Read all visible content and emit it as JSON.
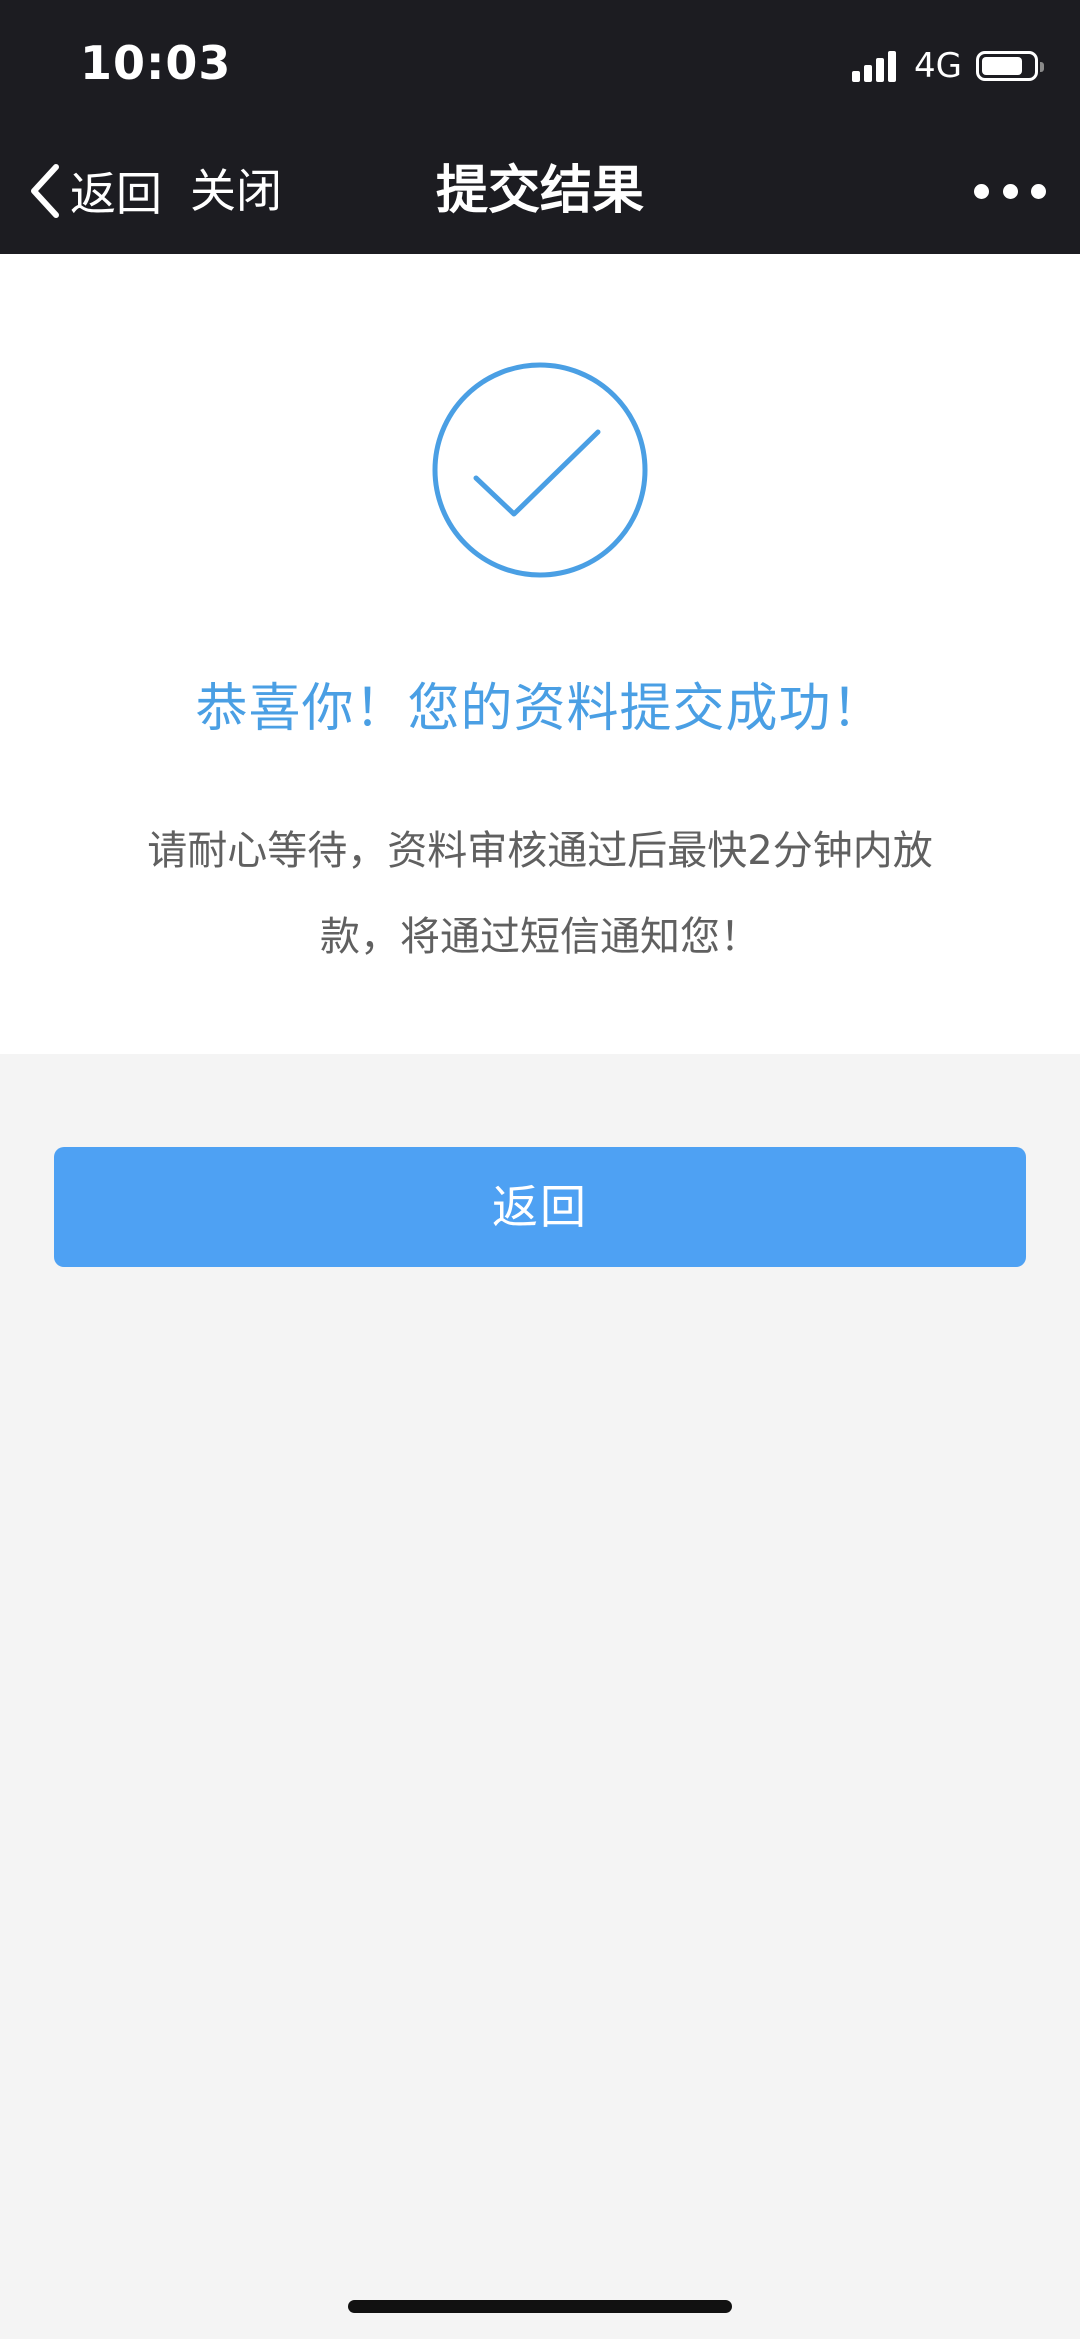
{
  "status_bar": {
    "time": "10:03",
    "network": "4G",
    "battery_level": 0.8,
    "signal_bars": 4
  },
  "navbar": {
    "back_label": "返回",
    "close_label": "关闭",
    "title": "提交结果"
  },
  "result": {
    "title": "恭喜你！您的资料提交成功！",
    "description_line1": "请耐心等待，资料审核通过后最快2分钟内放",
    "description_line2": "款，将通过短信通知您！",
    "accent_color": "#4a9fe4"
  },
  "actions": {
    "back_button_label": "返回",
    "button_color": "#4ea1f3"
  }
}
